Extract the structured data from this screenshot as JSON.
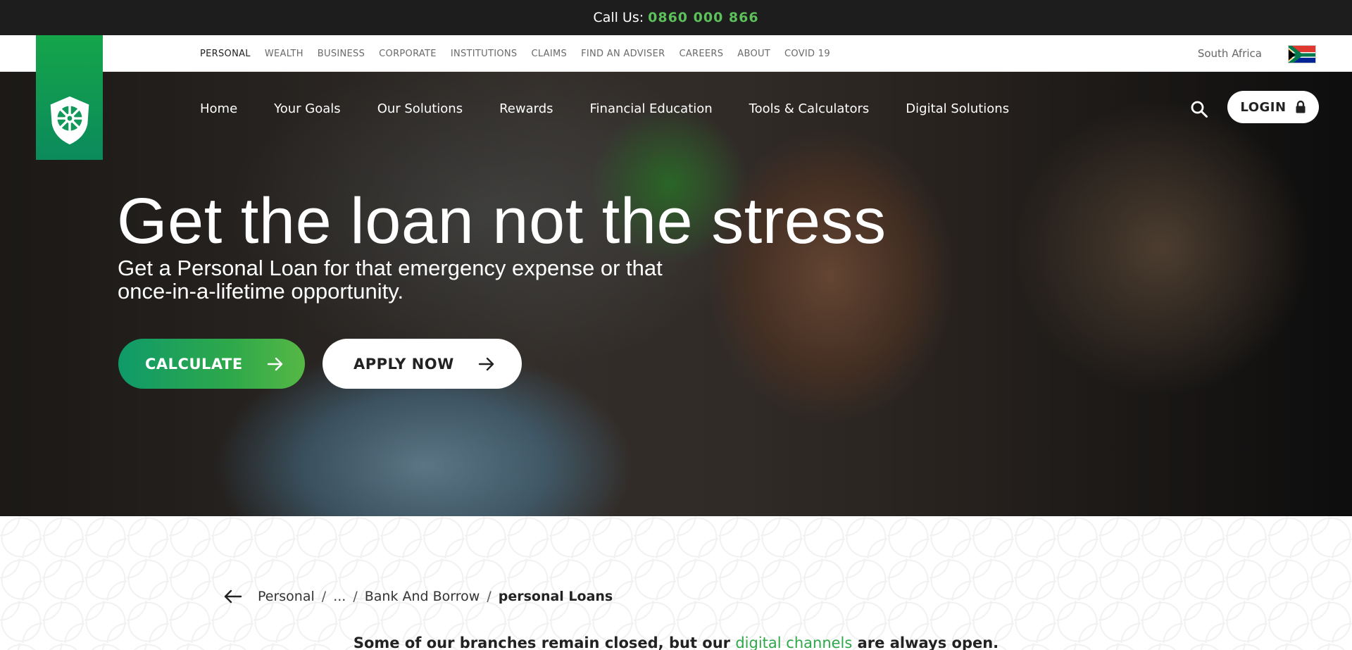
{
  "callbar": {
    "label": "Call Us:",
    "number": "0860 000 866"
  },
  "topnav": {
    "links": [
      "PERSONAL",
      "WEALTH",
      "BUSINESS",
      "CORPORATE",
      "INSTITUTIONS",
      "CLAIMS",
      "FIND AN ADVISER",
      "CAREERS",
      "ABOUT",
      "COVID 19"
    ],
    "active": "PERSONAL",
    "region": "South Africa"
  },
  "mainnav": {
    "items": [
      "Home",
      "Your Goals",
      "Our Solutions",
      "Rewards",
      "Financial Education",
      "Tools & Calculators",
      "Digital Solutions"
    ],
    "login_label": "LOGIN"
  },
  "hero": {
    "title": "Get the loan not the stress",
    "subtitle": "Get a Personal Loan for that emergency expense or that once-in-a-lifetime opportunity.",
    "calculate_label": "CALCULATE",
    "apply_label": "APPLY NOW"
  },
  "breadcrumb": {
    "items": [
      "Personal",
      "...",
      "Bank And Borrow"
    ],
    "current": "personal Loans"
  },
  "notice": {
    "before": "Some of our branches remain closed, but our",
    "link": "digital channels",
    "after": "are always open."
  },
  "colors": {
    "brand_green": "#2ea84a",
    "dark_bar": "#1d1d1d"
  }
}
